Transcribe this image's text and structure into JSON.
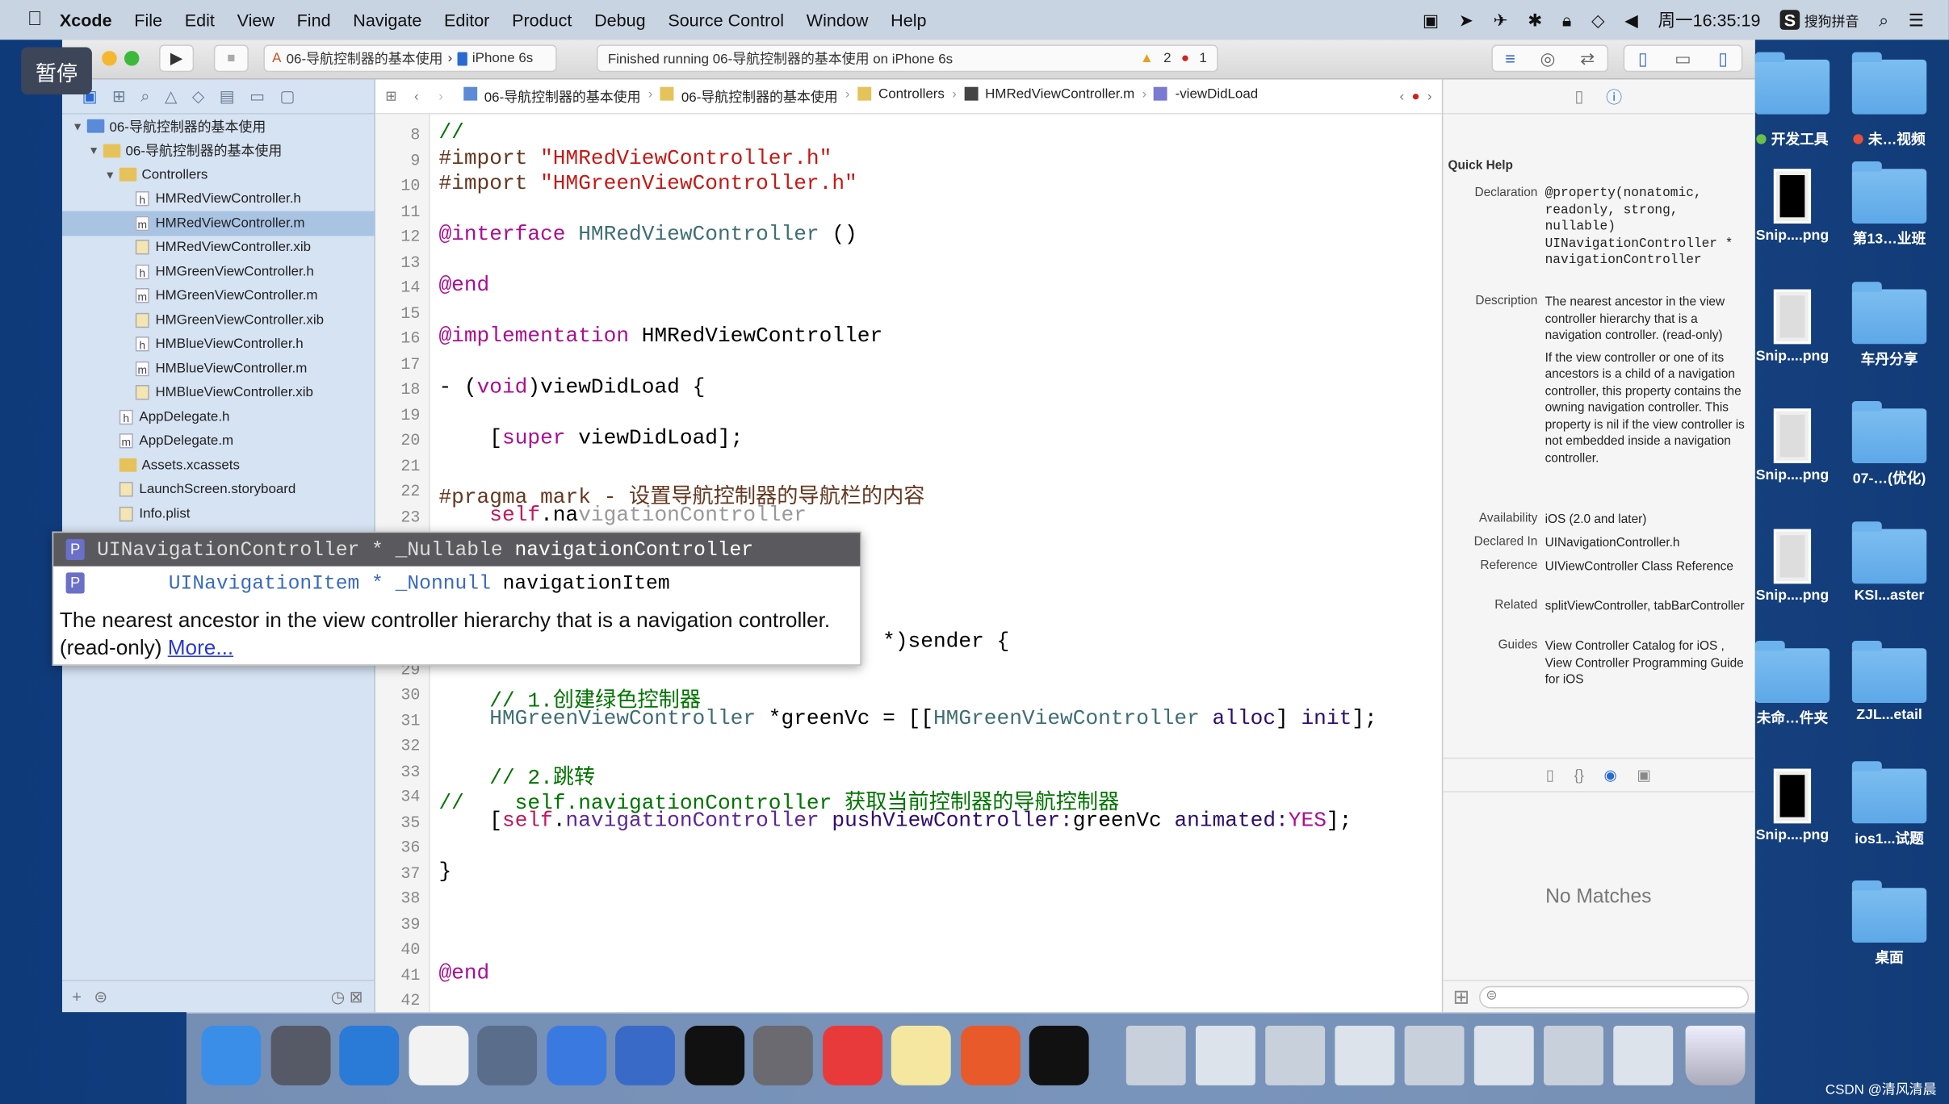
{
  "menubar": {
    "app": "Xcode",
    "items": [
      "File",
      "Edit",
      "View",
      "Find",
      "Navigate",
      "Editor",
      "Product",
      "Debug",
      "Source Control",
      "Window",
      "Help"
    ],
    "clock": "周一16:35:19",
    "ime": "搜狗拼音"
  },
  "overlay": {
    "pause": "暂停"
  },
  "toolbar": {
    "scheme": "06-导航控制器的基本使用",
    "device": "iPhone 6s",
    "activity": "Finished running 06-导航控制器的基本使用 on iPhone 6s",
    "warnings": "2",
    "errors": "1"
  },
  "navigator": {
    "items": [
      {
        "label": "06-导航控制器的基本使用",
        "kind": "project",
        "indent": 0,
        "disclosure": "▼"
      },
      {
        "label": "06-导航控制器的基本使用",
        "kind": "folder",
        "indent": 1,
        "disclosure": "▼"
      },
      {
        "label": "Controllers",
        "kind": "folder",
        "indent": 2,
        "disclosure": "▼"
      },
      {
        "label": "HMRedViewController.h",
        "kind": "h",
        "indent": 3
      },
      {
        "label": "HMRedViewController.m",
        "kind": "m",
        "indent": 3,
        "selected": true
      },
      {
        "label": "HMRedViewController.xib",
        "kind": "xib",
        "indent": 3
      },
      {
        "label": "HMGreenViewController.h",
        "kind": "h",
        "indent": 3
      },
      {
        "label": "HMGreenViewController.m",
        "kind": "m",
        "indent": 3
      },
      {
        "label": "HMGreenViewController.xib",
        "kind": "xib",
        "indent": 3
      },
      {
        "label": "HMBlueViewController.h",
        "kind": "h",
        "indent": 3
      },
      {
        "label": "HMBlueViewController.m",
        "kind": "m",
        "indent": 3
      },
      {
        "label": "HMBlueViewController.xib",
        "kind": "xib",
        "indent": 3
      },
      {
        "label": "AppDelegate.h",
        "kind": "h",
        "indent": 2
      },
      {
        "label": "AppDelegate.m",
        "kind": "m",
        "indent": 2
      },
      {
        "label": "Assets.xcassets",
        "kind": "folder",
        "indent": 2
      },
      {
        "label": "LaunchScreen.storyboard",
        "kind": "xib",
        "indent": 2
      },
      {
        "label": "Info.plist",
        "kind": "xib",
        "indent": 2
      }
    ]
  },
  "jumpbar": {
    "crumbs": [
      "06-导航控制器的基本使用",
      "06-导航控制器的基本使用",
      "Controllers",
      "HMRedViewController.m",
      "-viewDidLoad"
    ]
  },
  "code": {
    "lines": [
      {
        "n": "8",
        "y": 0,
        "t": [
          [
            "//",
            "c"
          ]
        ]
      },
      {
        "n": "9",
        "y": 1,
        "t": [
          [
            "#import ",
            "pp"
          ],
          [
            "\"HMRedViewController.h\"",
            "s"
          ]
        ]
      },
      {
        "n": "10",
        "y": 2,
        "t": [
          [
            "#import ",
            "pp"
          ],
          [
            "\"HMGreenViewController.h\"",
            "s"
          ]
        ]
      },
      {
        "n": "11",
        "y": 3,
        "t": []
      },
      {
        "n": "12",
        "y": 4,
        "t": [
          [
            "@interface ",
            "k"
          ],
          [
            "HMRedViewController",
            "cls"
          ],
          [
            " ()",
            ""
          ]
        ]
      },
      {
        "n": "13",
        "y": 5,
        "t": []
      },
      {
        "n": "14",
        "y": 6,
        "t": [
          [
            "@end",
            "k"
          ]
        ]
      },
      {
        "n": "15",
        "y": 7,
        "t": []
      },
      {
        "n": "16",
        "y": 8,
        "t": [
          [
            "@implementation ",
            "k"
          ],
          [
            "HMRedViewController",
            ""
          ]
        ]
      },
      {
        "n": "17",
        "y": 9,
        "t": []
      },
      {
        "n": "18",
        "y": 10,
        "t": [
          [
            "- (",
            ""
          ],
          [
            "void",
            "k"
          ],
          [
            ")viewDidLoad {",
            ""
          ]
        ]
      },
      {
        "n": "19",
        "y": 11,
        "t": []
      },
      {
        "n": "20",
        "y": 12,
        "t": [
          [
            "    [",
            ""
          ],
          [
            "super",
            "k"
          ],
          [
            " viewDidLoad];",
            ""
          ]
        ]
      },
      {
        "n": "21",
        "y": 13,
        "t": []
      },
      {
        "n": "22",
        "y": 14,
        "t": [
          [
            "#pragma mark - 设置导航控制器的导航栏的内容",
            "pp"
          ]
        ]
      },
      {
        "n": "23",
        "y": 15,
        "t": [
          [
            "    self",
            "sf"
          ],
          [
            ".na",
            ""
          ],
          [
            "vigationController",
            "g"
          ]
        ]
      },
      {
        "n": "",
        "y": 20,
        "t": [
          [
            "                                   *)sender {",
            ""
          ]
        ]
      },
      {
        "n": "29",
        "y": 21,
        "t": []
      },
      {
        "n": "30",
        "y": 22,
        "t": [
          [
            "    // 1.创建绿色控制器",
            "c"
          ]
        ]
      },
      {
        "n": "31",
        "y": 23,
        "t": [
          [
            "    HMGreenViewController",
            "cls"
          ],
          [
            " *greenVc = [[",
            ""
          ],
          [
            "HMGreenViewController",
            "cls"
          ],
          [
            " ",
            ""
          ],
          [
            "alloc",
            "m"
          ],
          [
            "] ",
            ""
          ],
          [
            "init",
            "m"
          ],
          [
            "];",
            ""
          ]
        ]
      },
      {
        "n": "32",
        "y": 24,
        "t": []
      },
      {
        "n": "33",
        "y": 25,
        "t": [
          [
            "    // 2.跳转",
            "c"
          ]
        ]
      },
      {
        "n": "34",
        "y": 26,
        "t": [
          [
            "//    self.navigationController 获取当前控制器的导航控制器",
            "c"
          ]
        ]
      },
      {
        "n": "35",
        "y": 27,
        "t": [
          [
            "    [",
            ""
          ],
          [
            "self",
            "sf"
          ],
          [
            ".",
            ""
          ],
          [
            "navigationController",
            "p"
          ],
          [
            " ",
            ""
          ],
          [
            "pushViewController:",
            "m"
          ],
          [
            "greenVc ",
            ""
          ],
          [
            "animated:",
            "m"
          ],
          [
            "YES",
            "k"
          ],
          [
            "];",
            ""
          ]
        ]
      },
      {
        "n": "36",
        "y": 28,
        "t": []
      },
      {
        "n": "37",
        "y": 29,
        "t": [
          [
            "}",
            ""
          ]
        ]
      },
      {
        "n": "38",
        "y": 30,
        "t": []
      },
      {
        "n": "39",
        "y": 31,
        "t": []
      },
      {
        "n": "40",
        "y": 32,
        "t": []
      },
      {
        "n": "41",
        "y": 33,
        "t": [
          [
            "@end",
            "k"
          ]
        ]
      },
      {
        "n": "42",
        "y": 34,
        "t": []
      }
    ]
  },
  "completion": {
    "items": [
      {
        "badge": "P",
        "type": "UINavigationController * _Nullable ",
        "name": "navigationController",
        "selected": true
      },
      {
        "badge": "P",
        "type": "      UINavigationItem * _Nonnull ",
        "name": "navigationItem",
        "selected": false
      }
    ],
    "description": "The nearest ancestor in the view controller hierarchy that is a navigation controller. (read-only)",
    "more": "More..."
  },
  "quick_help": {
    "title": "Quick Help",
    "declaration": "  @property(nonatomic, readonly, strong, nullable) UINavigationController * navigationController",
    "description": "The nearest ancestor in the view controller hierarchy that is a navigation controller. (read-only)",
    "discussion": "If the view controller or one of its ancestors is a child of a navigation controller, this property contains the owning navigation controller. This property is nil if the view controller is not embedded inside a navigation controller.",
    "rows": [
      {
        "label": "Availability",
        "value": "iOS (2.0 and later)",
        "link": false
      },
      {
        "label": "Declared In",
        "value": "UINavigationController.h",
        "link": true
      },
      {
        "label": "Reference",
        "value": "UIViewController Class Reference",
        "link": true
      },
      {
        "label": "Related",
        "value": "splitViewController, tabBarController",
        "link": true
      },
      {
        "label": "Guides",
        "value": "View Controller Catalog for iOS , View Controller Programming Guide for iOS",
        "link": true
      }
    ],
    "labels": {
      "declaration": "Declaration",
      "description": "Description"
    },
    "library_empty": "No Matches"
  },
  "desktop": {
    "items": [
      {
        "label": "",
        "type": "folder"
      },
      {
        "label": "",
        "type": "folder"
      },
      {
        "label": "开发工具",
        "type": "tag",
        "dot": "#6cc04a"
      },
      {
        "label": "未…视频",
        "type": "tag",
        "dot": "#e8503a"
      },
      {
        "label": "Snip....png",
        "type": "thumb"
      },
      {
        "label": "第13…业班",
        "type": "folder"
      },
      {
        "label": "Snip....png",
        "type": "thumb"
      },
      {
        "label": "车丹分享",
        "type": "folder"
      },
      {
        "label": "Snip....png",
        "type": "thumb"
      },
      {
        "label": "07-…(优化)",
        "type": "folder"
      },
      {
        "label": "Snip....png",
        "type": "thumb"
      },
      {
        "label": "KSI...aster",
        "type": "folder"
      },
      {
        "label": "未命…件夹",
        "type": "folder"
      },
      {
        "label": "ZJL...etail",
        "type": "folder"
      },
      {
        "label": "Snip....png",
        "type": "thumb"
      },
      {
        "label": "ios1...试题",
        "type": "folder"
      },
      {
        "label": "",
        "type": "none"
      },
      {
        "label": "桌面",
        "type": "folder"
      }
    ]
  },
  "dock": {
    "apps": [
      "finder",
      "launchpad",
      "safari",
      "mouse",
      "photo-slideshow",
      "xcode",
      "instruments",
      "terminal",
      "system-preferences",
      "xmind",
      "notes",
      "powerpoint",
      "console"
    ],
    "colors": [
      "#3a8ee8",
      "#555a66",
      "#2a7ad8",
      "#f2f2f2",
      "#5a6e8c",
      "#3a7ae0",
      "#3a6ac8",
      "#111",
      "#6a6a70",
      "#e83a3a",
      "#f5e7a0",
      "#e85a2a",
      "#111"
    ]
  },
  "watermark": "CSDN @清风清晨"
}
